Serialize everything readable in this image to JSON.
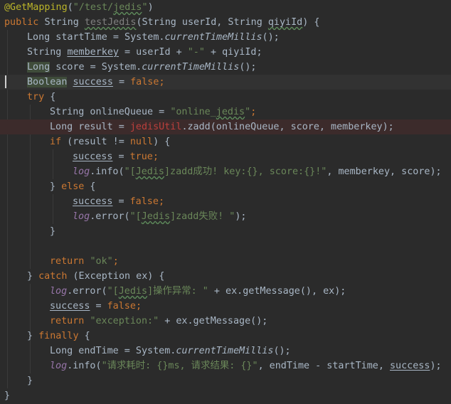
{
  "colors": {
    "background": "#2b2b2b",
    "text": "#a9b7c6",
    "keyword": "#cc7832",
    "string": "#6a8759",
    "annotation": "#bbb529",
    "field": "#9876aa",
    "error": "#bc3f3c"
  },
  "code": {
    "l1": {
      "ann": "@GetMapping",
      "p1": "(",
      "s1": "\"/test/",
      "s2": "jedis",
      "s3": "\"",
      "p2": ")"
    },
    "l2": {
      "k1": "public ",
      "t1": "String ",
      "m1": "testJedis",
      "p1": "(String userId, String ",
      "id1": "qiyiId",
      "p2": ") {"
    },
    "l3": {
      "t1": "Long startTime = System.",
      "m1": "currentTimeMillis",
      "p1": "();"
    },
    "l4": {
      "t1": "String ",
      "v1": "memberkey",
      "p1": " = userId + ",
      "s1": "\"-\"",
      "p2": " + qiyiId;"
    },
    "l5": {
      "t1": "Long",
      "p1": " score = System.",
      "m1": "currentTimeMillis",
      "p2": "();"
    },
    "l6": {
      "t1": "Boolean",
      "p1": " ",
      "v1": "success",
      "p2": " = ",
      "k1": "false",
      "p3": ";"
    },
    "l7": {
      "k1": "try",
      "p1": " {"
    },
    "l8": {
      "t1": "String onlineQueue = ",
      "s1": "\"online_",
      "s2": "jedis",
      "s3": "\"",
      "p1": ";"
    },
    "l9": {
      "t1": "Long result = ",
      "e1": "jedisUtil",
      "p1": ".zadd(onlineQueue, score, memberkey);"
    },
    "l10": {
      "k1": "if",
      "p1": " (result != ",
      "k2": "null",
      "p2": ") {"
    },
    "l11": {
      "v1": "success",
      "p1": " = ",
      "k1": "true",
      "p2": ";"
    },
    "l12": {
      "f1": "log",
      "p1": ".info(",
      "s1": "\"[",
      "s2": "Jedis",
      "s3": "]zadd成功! key:{}, score:{}!\"",
      "p2": ", memberkey, score);"
    },
    "l13": {
      "p1": "} ",
      "k1": "else",
      "p2": " {"
    },
    "l14": {
      "v1": "success",
      "p1": " = ",
      "k1": "false",
      "p2": ";"
    },
    "l15": {
      "f1": "log",
      "p1": ".error(",
      "s1": "\"[",
      "s2": "Jedis",
      "s3": "]zadd失败! \"",
      "p2": ");"
    },
    "l16": {
      "p1": "}"
    },
    "l18": {
      "k1": "return ",
      "s1": "\"ok\"",
      "p1": ";"
    },
    "l19": {
      "p1": "} ",
      "k1": "catch",
      "p2": " (Exception ex) {"
    },
    "l20": {
      "f1": "log",
      "p1": ".error(",
      "s1": "\"[",
      "s2": "Jedis",
      "s3": "]操作异常: \"",
      "p2": " + ex.getMessage(), ex);"
    },
    "l21": {
      "v1": "success",
      "p1": " = ",
      "k1": "false",
      "p2": ";"
    },
    "l22": {
      "k1": "return ",
      "s1": "\"exception:\"",
      "p1": " + ex.getMessage();"
    },
    "l23": {
      "p1": "} ",
      "k1": "finally",
      "p2": " {"
    },
    "l24": {
      "t1": "Long endTime = System.",
      "m1": "currentTimeMillis",
      "p1": "();"
    },
    "l25": {
      "f1": "log",
      "p1": ".info(",
      "s1": "\"请求耗时: {}ms, 请求结果: {}\"",
      "p2": ", endTime - startTime, ",
      "v1": "success",
      "p3": ");"
    },
    "l26": {
      "p1": "}"
    },
    "l27": {
      "p1": "}"
    }
  }
}
